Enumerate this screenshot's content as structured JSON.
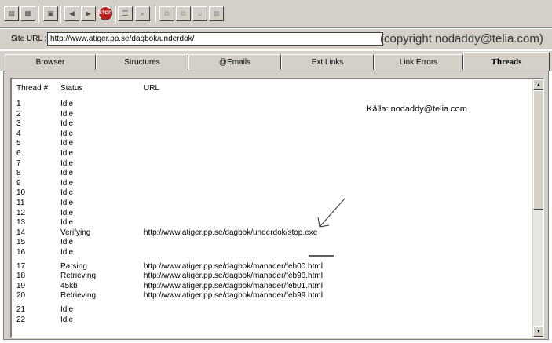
{
  "toolbar": {
    "buttons": [
      {
        "icon": "open-icon",
        "glyph": "▤"
      },
      {
        "icon": "save-icon",
        "glyph": "▦"
      },
      {
        "icon": "print-icon",
        "glyph": "▣"
      },
      {
        "icon": "back-icon",
        "glyph": "◀"
      },
      {
        "icon": "forward-icon",
        "glyph": "▶"
      },
      {
        "icon": "stop-icon",
        "glyph": "STOP"
      },
      {
        "icon": "checklist-icon",
        "glyph": "☰"
      },
      {
        "icon": "search-icon",
        "glyph": "⌕"
      },
      {
        "icon": "copy-icon",
        "glyph": "⧉"
      },
      {
        "icon": "paste-icon",
        "glyph": "⧉"
      },
      {
        "icon": "tree-icon",
        "glyph": "≡"
      },
      {
        "icon": "grid-icon",
        "glyph": "▦"
      }
    ]
  },
  "site_url": {
    "label": "Site URL :",
    "value": "http://www.atiger.pp.se/dagbok/underdok/"
  },
  "copyright": "(copyright nodaddy@telia.com)",
  "tabs": [
    {
      "label": "Browser",
      "active": false
    },
    {
      "label": "Structures",
      "active": false
    },
    {
      "label": "@Emails",
      "active": false
    },
    {
      "label": "Ext Links",
      "active": false
    },
    {
      "label": "Link Errors",
      "active": false
    },
    {
      "label": "Threads",
      "active": true
    }
  ],
  "table": {
    "headers": {
      "num": "Thread #",
      "status": "Status",
      "url": "URL"
    },
    "rows": [
      {
        "num": "1",
        "status": "Idle",
        "url": ""
      },
      {
        "num": "2",
        "status": "Idle",
        "url": ""
      },
      {
        "num": "3",
        "status": "Idle",
        "url": ""
      },
      {
        "num": "4",
        "status": "Idle",
        "url": ""
      },
      {
        "num": "5",
        "status": "Idle",
        "url": ""
      },
      {
        "num": "6",
        "status": "Idle",
        "url": ""
      },
      {
        "num": "7",
        "status": "Idle",
        "url": ""
      },
      {
        "num": "8",
        "status": "Idle",
        "url": ""
      },
      {
        "num": "9",
        "status": "Idle",
        "url": ""
      },
      {
        "num": "10",
        "status": "Idle",
        "url": ""
      },
      {
        "num": "11",
        "status": "Idle",
        "url": ""
      },
      {
        "num": "12",
        "status": "Idle",
        "url": ""
      },
      {
        "num": "13",
        "status": "Idle",
        "url": ""
      },
      {
        "num": "14",
        "status": "Verifying",
        "url": "http://www.atiger.pp.se/dagbok/underdok/stop.exe"
      },
      {
        "num": "15",
        "status": "Idle",
        "url": ""
      },
      {
        "num": "16",
        "status": "Idle",
        "url": ""
      },
      {
        "num": "17",
        "status": "Parsing",
        "url": "http://www.atiger.pp.se/dagbok/manader/feb00.html"
      },
      {
        "num": "18",
        "status": "Retrieving",
        "url": "http://www.atiger.pp.se/dagbok/manader/feb98.html"
      },
      {
        "num": "19",
        "status": "45kb",
        "url": "http://www.atiger.pp.se/dagbok/manader/feb01.html"
      },
      {
        "num": "20",
        "status": "Retrieving",
        "url": "http://www.atiger.pp.se/dagbok/manader/feb99.html"
      },
      {
        "num": "21",
        "status": "Idle",
        "url": ""
      },
      {
        "num": "22",
        "status": "Idle",
        "url": ""
      }
    ]
  },
  "annotation": {
    "source": "Källa: nodaddy@telia.com",
    "arrow_icon": "hand-drawn-arrow-icon",
    "underline_icon": "hand-drawn-underline-icon"
  },
  "scrollbar": {
    "up_icon": "scroll-up-icon",
    "down_icon": "scroll-down-icon"
  }
}
